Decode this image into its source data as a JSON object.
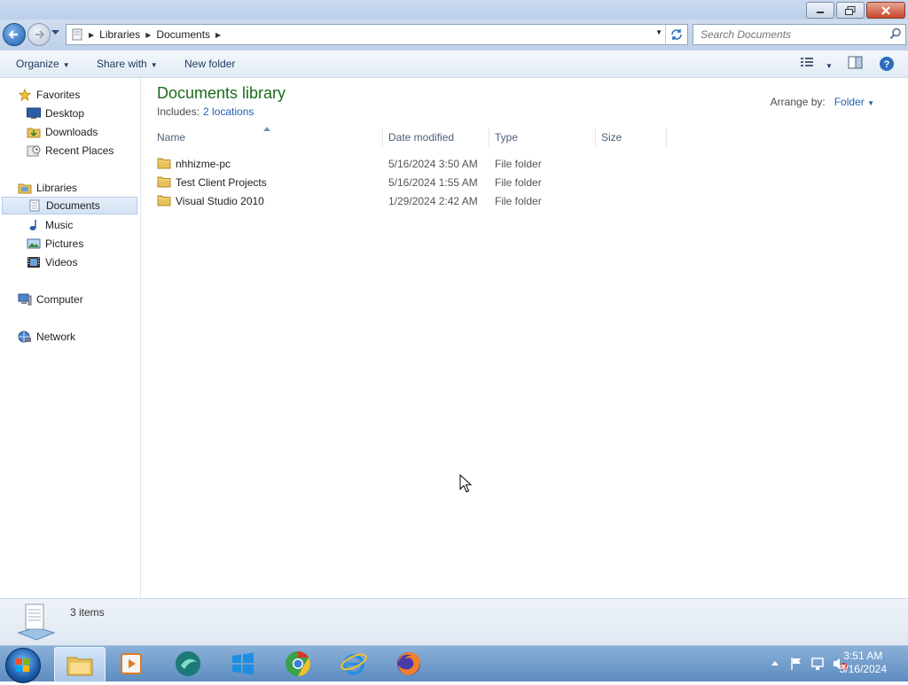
{
  "window": {
    "caption_buttons": [
      "minimize",
      "restore",
      "close"
    ]
  },
  "address": {
    "breadcrumb": [
      "Libraries",
      "Documents"
    ],
    "search_placeholder": "Search Documents"
  },
  "toolbar": {
    "organize": "Organize",
    "share_with": "Share with",
    "new_folder": "New folder"
  },
  "sidebar": {
    "favorites": {
      "label": "Favorites",
      "items": [
        "Desktop",
        "Downloads",
        "Recent Places"
      ]
    },
    "libraries": {
      "label": "Libraries",
      "items": [
        "Documents",
        "Music",
        "Pictures",
        "Videos"
      ],
      "selected": "Documents"
    },
    "computer": "Computer",
    "network": "Network"
  },
  "main": {
    "title": "Documents library",
    "includes_label": "Includes:",
    "includes_link": "2 locations",
    "arrange_label": "Arrange by:",
    "arrange_value": "Folder",
    "columns": [
      "Name",
      "Date modified",
      "Type",
      "Size"
    ],
    "rows": [
      {
        "name": "nhhizme-pc",
        "date": "5/16/2024 3:50 AM",
        "type": "File folder"
      },
      {
        "name": "Test Client Projects",
        "date": "5/16/2024 1:55 AM",
        "type": "File folder"
      },
      {
        "name": "Visual Studio 2010",
        "date": "1/29/2024 2:42 AM",
        "type": "File folder"
      }
    ]
  },
  "details": {
    "count": "3 items"
  },
  "taskbar": {
    "time": "3:51 AM",
    "date": "5/16/2024",
    "pinned": [
      "explorer-icon",
      "media-player-icon",
      "app-icon",
      "windows-store-icon",
      "chrome-icon",
      "ie-icon",
      "firefox-icon"
    ]
  },
  "colors": {
    "library_title": "#1c6a1c",
    "link": "#1f5fb8",
    "taskbar": "#5e8cc0"
  }
}
